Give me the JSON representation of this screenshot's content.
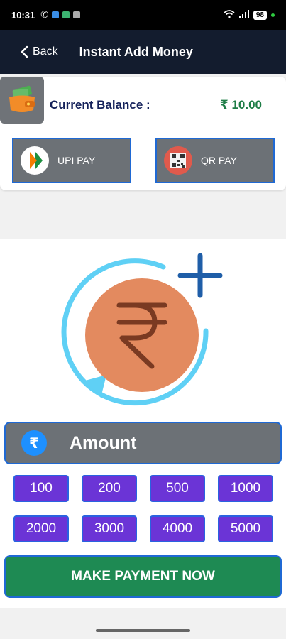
{
  "status_bar": {
    "time": "10:31",
    "battery": "98"
  },
  "header": {
    "back_label": "Back",
    "title": "Instant Add Money"
  },
  "balance": {
    "label": "Current Balance :",
    "value": "₹ 10.00"
  },
  "payment_methods": {
    "upi_label": "UPI PAY",
    "qr_label": "QR PAY"
  },
  "amount_section": {
    "rupee_symbol": "₹",
    "label": "Amount",
    "options": [
      "100",
      "200",
      "500",
      "1000",
      "2000",
      "3000",
      "4000",
      "5000"
    ]
  },
  "make_payment_label": "MAKE PAYMENT NOW",
  "colors": {
    "app_bar": "#131c2e",
    "balance_label": "#14215a",
    "balance_value": "#1e7d46",
    "amount_button": "#6b34d6",
    "pay_button": "#1e8a53",
    "border_blue": "#1f69d4",
    "coin": "#e38a5f",
    "arc": "#5fd0f5"
  },
  "icons": {
    "wallet": "wallet-icon",
    "upi": "upi-logo-icon",
    "qr": "qr-code-icon",
    "hero": "add-money-rupee-icon"
  }
}
